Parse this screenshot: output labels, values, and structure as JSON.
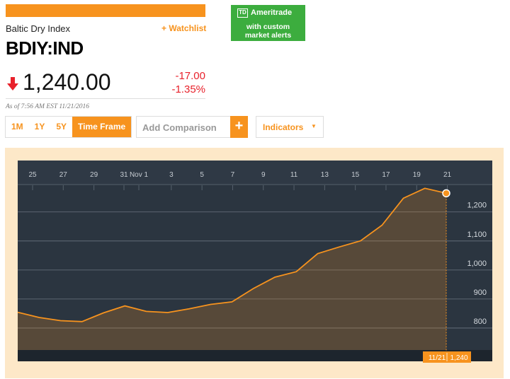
{
  "header": {
    "index_name": "Baltic Dry Index",
    "watchlist_label": "+ Watchlist",
    "ticker": "BDIY:IND",
    "price": "1,240.00",
    "change_abs": "-17.00",
    "change_pct": "-1.35%",
    "as_of": "As of 7:56 AM EST 11/21/2016",
    "direction": "down"
  },
  "ad": {
    "logo_text": "TD",
    "brand": "Ameritrade",
    "line1": "with custom",
    "line2": "market alerts",
    "color": "#3cad3e"
  },
  "controls": {
    "ranges": [
      "1M",
      "1Y",
      "5Y"
    ],
    "time_frame_label": "Time Frame",
    "add_comparison_label": "Add Comparison",
    "plus_label": "+",
    "indicators_label": "Indicators",
    "indicators_caret": "▼"
  },
  "colors": {
    "accent": "#f7931e",
    "negative": "#e8212b",
    "chart_bg": "#2b3540"
  },
  "chart_data": {
    "type": "area",
    "x_tick_labels": [
      "25",
      "27",
      "29",
      "31",
      "Nov 1",
      "3",
      "5",
      "7",
      "9",
      "11",
      "13",
      "15",
      "17",
      "19",
      "21"
    ],
    "y_ticks": [
      800,
      900,
      "1,000",
      "1,100",
      "1,200"
    ],
    "ylim": [
      700,
      1270
    ],
    "dates": [
      "10/24",
      "10/25",
      "10/26",
      "10/27",
      "10/28",
      "10/31",
      "11/1",
      "11/2",
      "11/3",
      "11/4",
      "11/7",
      "11/8",
      "11/9",
      "11/10",
      "11/11",
      "11/14",
      "11/15",
      "11/16",
      "11/17",
      "11/18",
      "11/21"
    ],
    "values": [
      830,
      812,
      801,
      798,
      828,
      852,
      833,
      829,
      842,
      857,
      866,
      912,
      951,
      970,
      1032,
      1055,
      1076,
      1130,
      1223,
      1257,
      1240
    ],
    "last_label_date": "11/21",
    "last_label_value": "1,240",
    "grid": true
  }
}
